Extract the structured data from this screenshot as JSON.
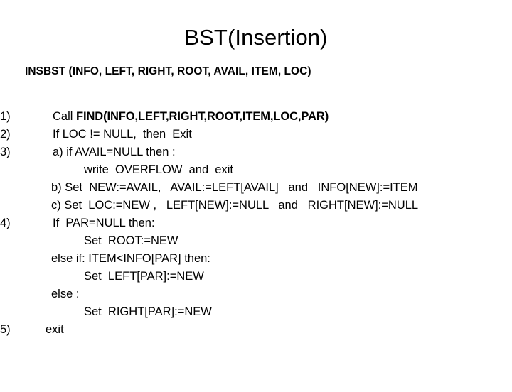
{
  "slide": {
    "title": "BST(Insertion)",
    "procedure_signature": "INSBST (INFO, LEFT, RIGHT, ROOT, AVAIL, ITEM, LOC)",
    "background_color": "#ffffff",
    "text_color": "#000000"
  },
  "pseudocode": {
    "lines": [
      {
        "marker": "1)",
        "text_plain": "Call ",
        "text_bold": "FIND(INFO,LEFT,RIGHT,ROOT,ITEM,LOC,PAR)"
      },
      {
        "marker": "2)",
        "text": "If LOC != NULL,  then  Exit"
      },
      {
        "marker": "3)",
        "text": "a) if AVAIL=NULL then :"
      },
      {
        "marker": "",
        "text": "write  OVERFLOW  and  exit"
      },
      {
        "marker": "",
        "text": "b) Set  NEW:=AVAIL,   AVAIL:=LEFT[AVAIL]   and   INFO[NEW]:=ITEM"
      },
      {
        "marker": "",
        "text": "c) Set  LOC:=NEW ,   LEFT[NEW]:=NULL   and   RIGHT[NEW]:=NULL"
      },
      {
        "marker": "4)",
        "text": "If  PAR=NULL then:"
      },
      {
        "marker": "",
        "text": "Set  ROOT:=NEW"
      },
      {
        "marker": "",
        "text": "else if: ITEM<INFO[PAR] then:"
      },
      {
        "marker": "",
        "text": "Set  LEFT[PAR]:=NEW"
      },
      {
        "marker": "",
        "text": "else :"
      },
      {
        "marker": "",
        "text": "Set  RIGHT[PAR]:=NEW"
      },
      {
        "marker": "5)",
        "text": "exit"
      }
    ]
  }
}
